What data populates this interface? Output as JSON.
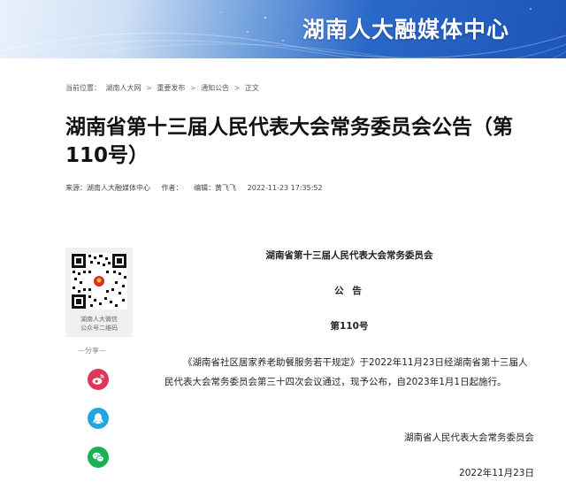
{
  "banner": {
    "title": "湖南人大融媒体中心"
  },
  "breadcrumb": {
    "prefix": "当前位置：",
    "items": [
      "湖南人大网",
      "重要发布",
      "通知公告",
      "正文"
    ],
    "separator": ">"
  },
  "article": {
    "title": "湖南省第十三届人民代表大会常务委员会公告（第110号）",
    "meta": {
      "source": "来源：湖南人大融媒体中心",
      "author": "作者：",
      "editor": "编辑：黄飞飞",
      "datetime": "2022-11-23 17:35:52"
    }
  },
  "sidebar": {
    "qr_caption_line1": "湖南人大微信",
    "qr_caption_line2": "公众号二维码",
    "share_label": "—分享—",
    "share_icons": [
      "weibo-icon",
      "qq-icon",
      "wechat-icon"
    ],
    "colors": {
      "weibo": "#e0365a",
      "qq": "#24a5de",
      "wechat": "#1ab153"
    }
  },
  "announcement": {
    "organization": "湖南省第十三届人民代表大会常务委员会",
    "heading": "公  告",
    "number": "第110号",
    "body": "《湖南省社区居家养老助餐服务若干规定》于2022年11月23日经湖南省第十三届人民代表大会常务委员会第三十四次会议通过，现予公布，自2023年1月1日起施行。",
    "signature": "湖南省人民代表大会常务委员会",
    "date": "2022年11月23日"
  }
}
